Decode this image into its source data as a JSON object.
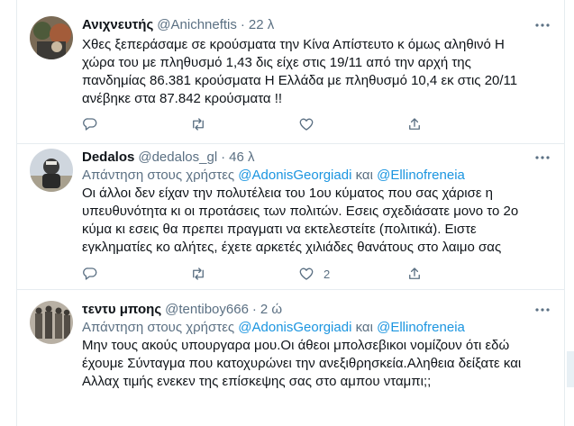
{
  "tweets": [
    {
      "name": "Ανιχνευτής",
      "handle": "@Anichneftis",
      "dot": "·",
      "time": "22 λ",
      "text": "Χθες ξεπεράσαμε σε κρούσματα την Κίνα Απίστευτο κ όμως αληθινό Η\nχώρα του με πληθυσμό 1,43 δις είχε στις 19/11 από την αρχή της\nπανδημίας 86.381 κρούσματα Η Ελλάδα με πληθυσμό 10,4 εκ στις 20/11\nανέβηκε στα 87.842 κρούσματα !!",
      "like_count": ""
    },
    {
      "name": "Dedalos",
      "handle": "@dedalos_gl",
      "dot": "·",
      "time": "46 λ",
      "reply_prefix": "Απάντηση στους χρήστες",
      "mention1": "@AdonisGeorgiadi",
      "and": "και",
      "mention2": "@Ellinofreneia",
      "text": "Οι άλλοι δεν είχαν την πολυτέλεια του 1ου κύματος που σας χάρισε η\nυπευθυνότητα κι οι προτάσεις των πολιτών. Εσεις σχεδιάσατε μονο το 2ο\nκύμα κι εσεις θα πρεπει πραγματι να εκτελεστείτε (πολιτικά). Ειστε\nεγκληματίες κο αλήτες, έχετε αρκετές χιλιάδες θανάτους στο λαιμο σας",
      "like_count": "2"
    },
    {
      "name": "τεντυ μποης",
      "handle": "@tentiboy666",
      "dot": "·",
      "time": "2 ώ",
      "reply_prefix": "Απάντηση στους χρήστες",
      "mention1": "@AdonisGeorgiadi",
      "and": "και",
      "mention2": "@Ellinofreneia",
      "text": "Μην τους ακούς υπουργαρα μου.Οι άθεοι μπολσεβικοι νομίζουν ότι εδώ\nέχουμε Σύνταγμα που κατοχυρώνει την ανεξιθρησκεία.Αληθεια δείξατε και\nΑλλαχ τιμής ενεκεν της επίσκεψης σας στο αμπου νταμπι;;"
    }
  ],
  "icons": {
    "more": "more-horizontal-icon",
    "reply": "reply-icon",
    "retweet": "retweet-icon",
    "like": "heart-icon",
    "share": "share-icon"
  },
  "colors": {
    "text": "#0f1419",
    "secondary": "#5b7083",
    "link": "#1b95e0",
    "border": "#e6ecf0"
  }
}
